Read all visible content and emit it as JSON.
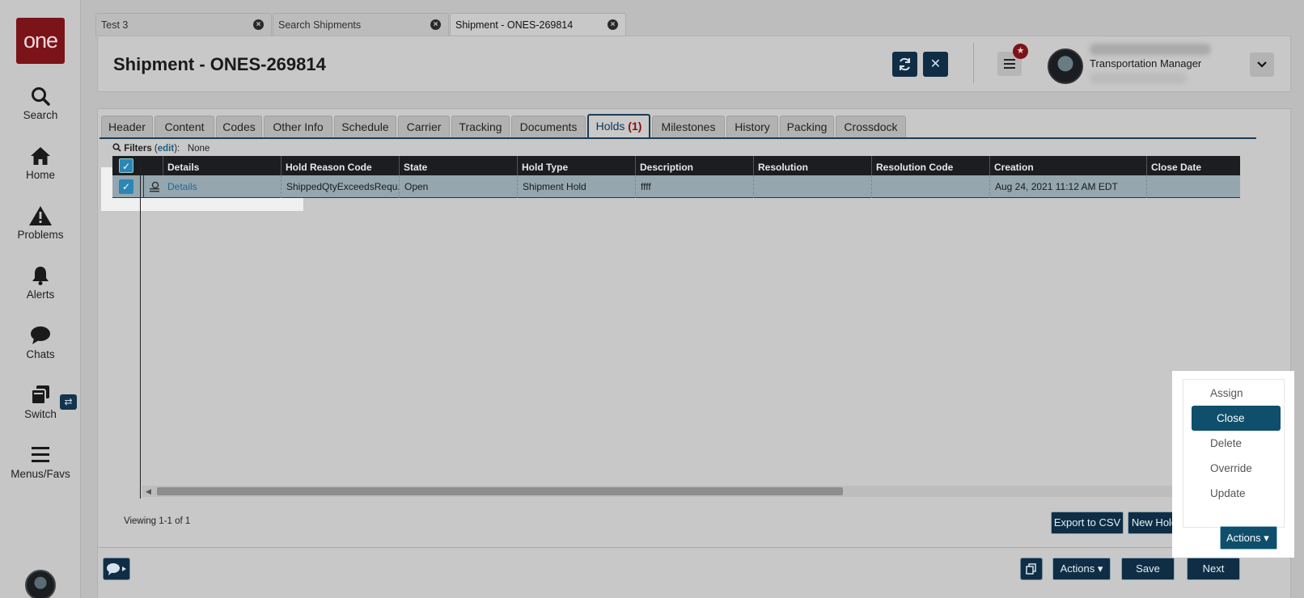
{
  "app": {
    "logo": "one"
  },
  "nav": [
    {
      "label": "Search",
      "icon": "search-icon"
    },
    {
      "label": "Home",
      "icon": "home-icon"
    },
    {
      "label": "Problems",
      "icon": "warning-icon"
    },
    {
      "label": "Alerts",
      "icon": "bell-icon"
    },
    {
      "label": "Chats",
      "icon": "chat-icon"
    },
    {
      "label": "Switch",
      "icon": "switch-icon"
    },
    {
      "label": "Menus/Favs",
      "icon": "menu-icon"
    }
  ],
  "tabs": [
    {
      "label": "Test 3"
    },
    {
      "label": "Search Shipments"
    },
    {
      "label": "Shipment - ONES-269814"
    }
  ],
  "header": {
    "title": "Shipment - ONES-269814",
    "user_role": "Transportation Manager"
  },
  "subtabs": [
    {
      "label": "Header"
    },
    {
      "label": "Content"
    },
    {
      "label": "Codes"
    },
    {
      "label": "Other Info"
    },
    {
      "label": "Schedule"
    },
    {
      "label": "Carrier"
    },
    {
      "label": "Tracking"
    },
    {
      "label": "Documents"
    },
    {
      "label": "Holds",
      "count": "(1)"
    },
    {
      "label": "Milestones"
    },
    {
      "label": "History"
    },
    {
      "label": "Packing"
    },
    {
      "label": "Crossdock"
    }
  ],
  "filters": {
    "label": "Filters",
    "edit": "edit",
    "value": "None"
  },
  "grid": {
    "columns": [
      "Details",
      "Hold Reason Code",
      "State",
      "Hold Type",
      "Description",
      "Resolution",
      "Resolution Code",
      "Creation",
      "Close Date"
    ],
    "rows": [
      {
        "details": "Details",
        "hold_reason_code": "ShippedQtyExceedsRequ...",
        "state": "Open",
        "hold_type": "Shipment Hold",
        "description": "ffff",
        "resolution": "",
        "resolution_code": "",
        "creation": "Aug 24, 2021 11:12 AM EDT",
        "close_date": ""
      }
    ]
  },
  "footer": {
    "viewing": "Viewing 1-1 of 1",
    "export_csv": "Export to CSV",
    "new_hold": "New Hold",
    "actions": "Actions",
    "actions_bottom": "Actions",
    "save": "Save",
    "next": "Next"
  },
  "actions_menu": {
    "items": [
      "Assign",
      "Close",
      "Delete",
      "Override",
      "Update"
    ],
    "selected": "Close"
  },
  "colors": {
    "brand": "#7a1419",
    "primary_button": "#0f2e45",
    "selected_menu": "#0f4f6b",
    "holds_count": "#8a0c10"
  }
}
